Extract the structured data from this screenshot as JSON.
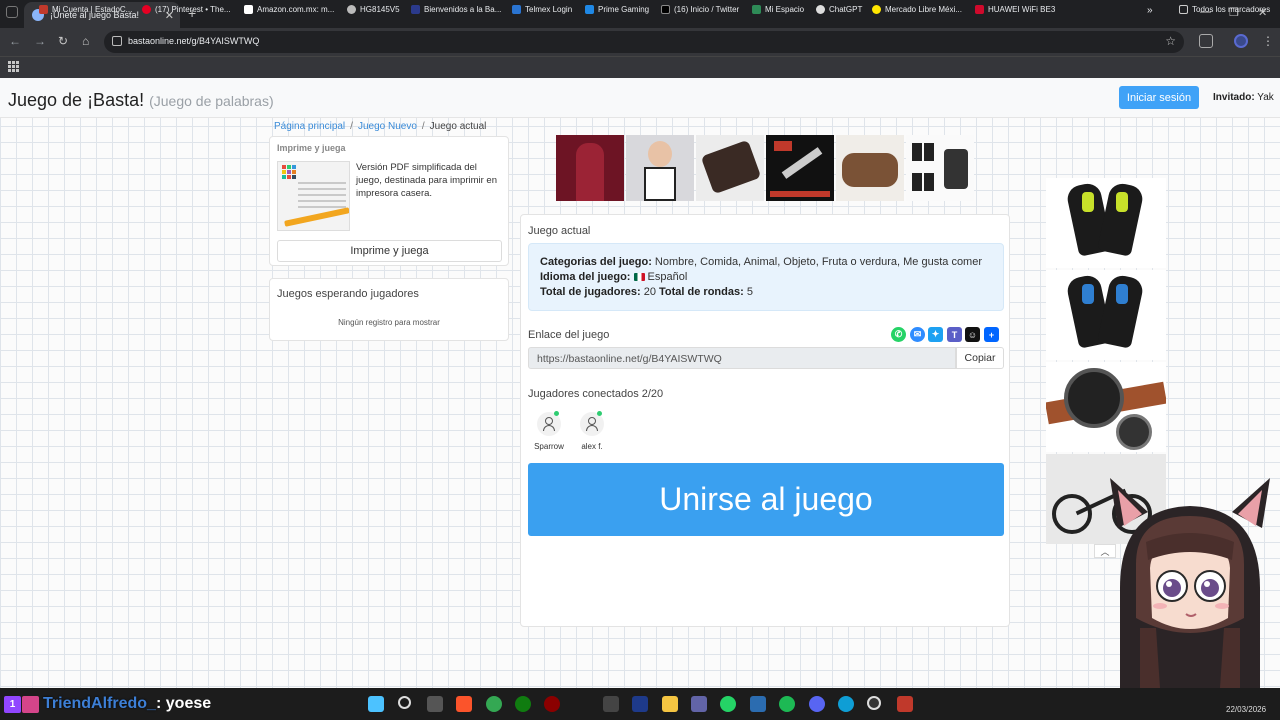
{
  "browser": {
    "tab_title": "¡Únete al juego Basta!",
    "url": "bastaonline.net/g/B4YAISWTWQ",
    "bookmarks": [
      "Mi Cuenta | EstadoC...",
      "(17) Pinterest • The...",
      "Amazon.com.mx: m...",
      "HG8145V5",
      "Bienvenidos a la Ba...",
      "Telmex Login",
      "Prime Gaming",
      "(16) Inicio / Twitter",
      "Mi Espacio",
      "ChatGPT",
      "Mercado Libre Méxi...",
      "HUAWEI WiFi BE3"
    ],
    "all_bookmarks": "Todos los marcadores"
  },
  "header": {
    "title": "Juego de ¡Basta!",
    "subtitle": "(Juego de palabras)",
    "login_label": "Iniciar sesión",
    "guest_prefix": "Invitado:",
    "guest_name": "Yak"
  },
  "breadcrumb": {
    "home": "Página principal",
    "new_game": "Juego Nuevo",
    "current": "Juego actual"
  },
  "print_card": {
    "heading": "Imprime y juega",
    "description": "Versión PDF simplificada del juego, destinada para imprimir en impresora casera.",
    "button": "Imprime y juega"
  },
  "waiting_card": {
    "heading": "Juegos esperando jugadores",
    "empty": "Ningún registro para mostrar"
  },
  "game": {
    "heading": "Juego actual",
    "categories_label": "Categorias del juego:",
    "categories": "Nombre, Comida, Animal, Objeto, Fruta o verdura, Me gusta comer",
    "language_label": "Idioma del juego:",
    "language": "Español",
    "players_label": "Total de jugadores:",
    "players_total": "20",
    "rounds_label": "Total de rondas:",
    "rounds_total": "5",
    "link_label": "Enlace del juego",
    "link": "https://bastaonline.net/g/B4YAISWTWQ",
    "copy": "Copiar",
    "connected_label": "Jugadores conectados 2/20",
    "players": [
      "Sparrow",
      "alex f."
    ],
    "join": "Unirse al juego"
  },
  "stream": {
    "chat_user": "TriendAlfredo_",
    "chat_message": ": yoese",
    "date": "22/03/2026"
  },
  "colors": {
    "accent": "#3aa0f0",
    "info_bg": "#e8f3fd",
    "link": "#3a8bd8"
  }
}
